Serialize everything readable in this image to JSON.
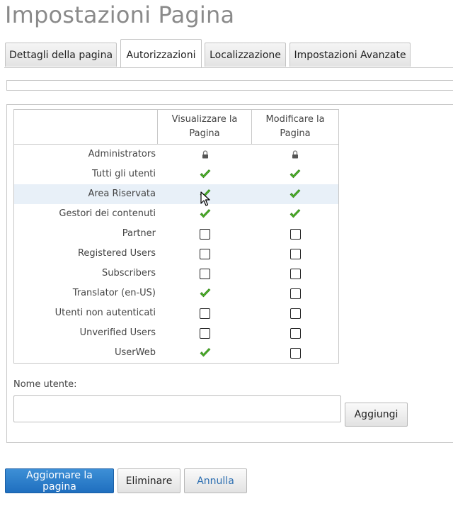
{
  "page": {
    "title": "Impostazioni Pagina"
  },
  "tabs": [
    {
      "label": "Dettagli della pagina",
      "active": false
    },
    {
      "label": "Autorizzazioni",
      "active": true
    },
    {
      "label": "Localizzazione",
      "active": false
    },
    {
      "label": "Impostazioni Avanzate",
      "active": false
    }
  ],
  "permissions": {
    "columns": [
      "Visualizzare la Pagina",
      "Modificare la Pagina"
    ],
    "rows": [
      {
        "role": "Administrators",
        "view": "locked",
        "edit": "locked"
      },
      {
        "role": "Tutti gli utenti",
        "view": "granted",
        "edit": "granted"
      },
      {
        "role": "Area Riservata",
        "view": "granted",
        "edit": "granted"
      },
      {
        "role": "Gestori dei contenuti",
        "view": "granted",
        "edit": "granted"
      },
      {
        "role": "Partner",
        "view": "unchecked",
        "edit": "unchecked"
      },
      {
        "role": "Registered Users",
        "view": "unchecked",
        "edit": "unchecked"
      },
      {
        "role": "Subscribers",
        "view": "unchecked",
        "edit": "unchecked"
      },
      {
        "role": "Translator (en-US)",
        "view": "granted",
        "edit": "unchecked"
      },
      {
        "role": "Utenti non autenticati",
        "view": "unchecked",
        "edit": "unchecked"
      },
      {
        "role": "Unverified Users",
        "view": "unchecked",
        "edit": "unchecked"
      },
      {
        "role": "UserWeb",
        "view": "granted",
        "edit": "unchecked"
      }
    ]
  },
  "user_field": {
    "label": "Nome utente:",
    "value": "",
    "add_label": "Aggiungi"
  },
  "actions": {
    "update_label": "Aggiornare la pagina",
    "delete_label": "Eliminare",
    "cancel_label": "Annulla"
  },
  "colors": {
    "primary": "#2a7dc9",
    "check": "#4caf2a",
    "highlight_row": "#e8f0f8"
  }
}
